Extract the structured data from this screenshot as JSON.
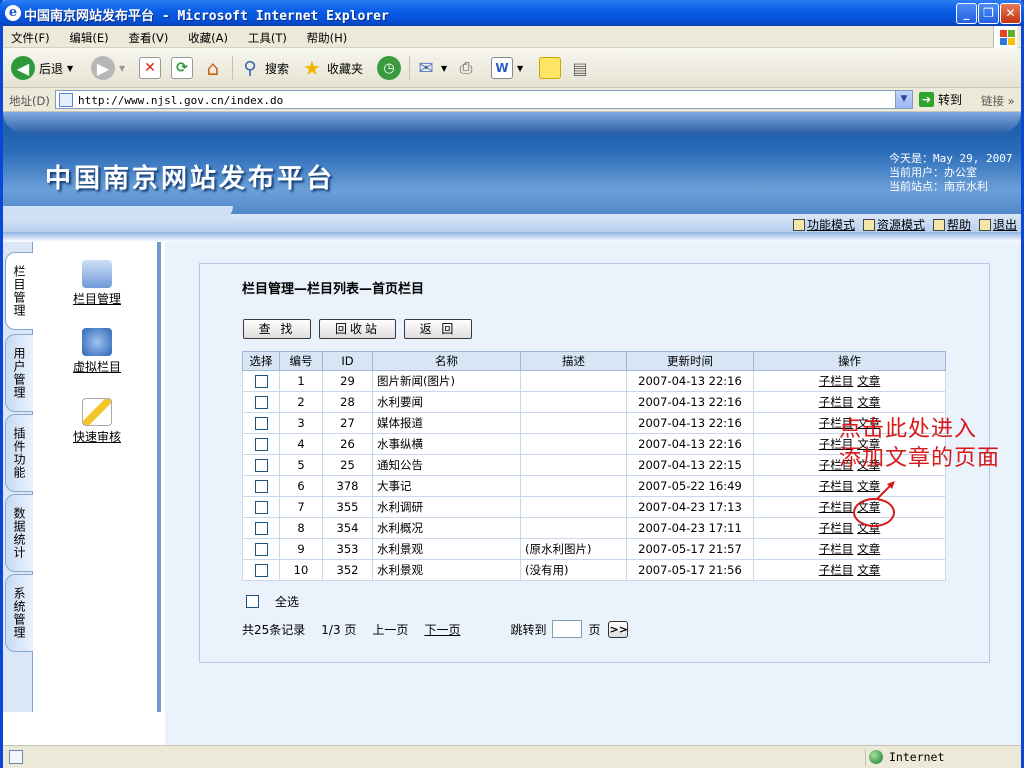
{
  "window": {
    "title": "中国南京网站发布平台 - Microsoft Internet Explorer"
  },
  "menu": [
    "文件(F)",
    "编辑(E)",
    "查看(V)",
    "收藏(A)",
    "工具(T)",
    "帮助(H)"
  ],
  "toolbar": {
    "back": "后退",
    "search": "搜索",
    "favorites": "收藏夹"
  },
  "address": {
    "label": "地址(D)",
    "url": "http://www.njsl.gov.cn/index.do",
    "go": "转到",
    "links": "链接"
  },
  "banner": {
    "site_title": "中国南京网站发布平台",
    "today": "今天是：May 29, 2007",
    "user": "当前用户：办公室",
    "site": "当前站点：南京水利",
    "nav": [
      "功能模式",
      "资源模式",
      "帮助",
      "退出"
    ]
  },
  "left_tabs": [
    "栏目管理",
    "用户管理",
    "插件功能",
    "数据统计",
    "系统管理"
  ],
  "side_items": [
    "栏目管理",
    "虚拟栏目",
    "快速审核"
  ],
  "main": {
    "heading": "栏目管理—栏目列表—首页栏目",
    "buttons": [
      "查 找",
      "回收站",
      "返 回"
    ],
    "columns": [
      "选择",
      "编号",
      "ID",
      "名称",
      "描述",
      "更新时间",
      "操作"
    ],
    "rows": [
      {
        "no": "1",
        "id": "29",
        "name": "图片新闻(图片)",
        "desc": "",
        "time": "2007-04-13 22:16"
      },
      {
        "no": "2",
        "id": "28",
        "name": "水利要闻",
        "desc": "",
        "time": "2007-04-13 22:16"
      },
      {
        "no": "3",
        "id": "27",
        "name": "媒体报道",
        "desc": "",
        "time": "2007-04-13 22:16"
      },
      {
        "no": "4",
        "id": "26",
        "name": "水事纵横",
        "desc": "",
        "time": "2007-04-13 22:16"
      },
      {
        "no": "5",
        "id": "25",
        "name": "通知公告",
        "desc": "",
        "time": "2007-04-13 22:15"
      },
      {
        "no": "6",
        "id": "378",
        "name": "大事记",
        "desc": "",
        "time": "2007-05-22 16:49"
      },
      {
        "no": "7",
        "id": "355",
        "name": "水利调研",
        "desc": "",
        "time": "2007-04-23 17:13"
      },
      {
        "no": "8",
        "id": "354",
        "name": "水利概况",
        "desc": "",
        "time": "2007-04-23 17:11"
      },
      {
        "no": "9",
        "id": "353",
        "name": "水利景观",
        "desc": "(原水利图片)",
        "time": "2007-05-17 21:57"
      },
      {
        "no": "10",
        "id": "352",
        "name": "水利景观",
        "desc": "(没有用)",
        "time": "2007-05-17 21:56"
      }
    ],
    "action_sub": "子栏目",
    "action_article": "文章",
    "select_all": "全选",
    "pager": {
      "total": "共25条记录",
      "page": "1/3 页",
      "prev": "上一页",
      "next": "下一页",
      "jump": "跳转到",
      "unit": "页",
      "go": ">>"
    }
  },
  "annotation": {
    "line1": "点击此处进入",
    "line2": "添加文章的页面"
  },
  "status": {
    "zone": "Internet"
  },
  "colors": {
    "annotation": "#d81818",
    "banner": "#2a6bb8",
    "titlebar": "#0a5ee8"
  }
}
